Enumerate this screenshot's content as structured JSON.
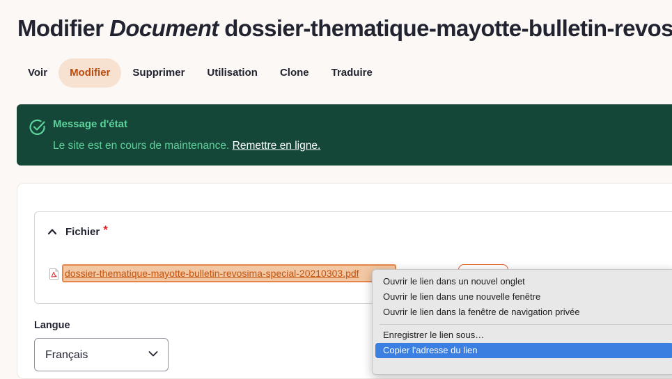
{
  "page": {
    "title_prefix": "Modifier ",
    "title_type": "Document",
    "title_suffix": " dossier-thematique-mayotte-bulletin-revos"
  },
  "tabs": [
    {
      "label": "Voir",
      "active": false
    },
    {
      "label": "Modifier",
      "active": true
    },
    {
      "label": "Supprimer",
      "active": false
    },
    {
      "label": "Utilisation",
      "active": false
    },
    {
      "label": "Clone",
      "active": false
    },
    {
      "label": "Traduire",
      "active": false
    }
  ],
  "status": {
    "heading": "Message d'état",
    "text": "Le site est en cours de maintenance. ",
    "link": "Remettre en ligne."
  },
  "file_field": {
    "legend": "Fichier",
    "required_marker": "*",
    "file_name": "dossier-thematique-mayotte-bulletin-revosima-special-20210303.pdf"
  },
  "language": {
    "label": "Langue",
    "value": "Français"
  },
  "context_menu": {
    "items": [
      {
        "label": "Ouvrir le lien dans un nouvel onglet",
        "selected": false
      },
      {
        "label": "Ouvrir le lien dans une nouvelle fenêtre",
        "selected": false
      },
      {
        "label": "Ouvrir le lien dans la fenêtre de navigation privée",
        "selected": false
      },
      {
        "label": "Enregistrer le lien sous…",
        "selected": false
      },
      {
        "label": "Copier l'adresse du lien",
        "selected": true
      }
    ]
  },
  "colors": {
    "accent": "#b94c10",
    "status_bg": "#154738",
    "status_text": "#5fd39c",
    "menu_highlight": "#3b7fe0"
  }
}
